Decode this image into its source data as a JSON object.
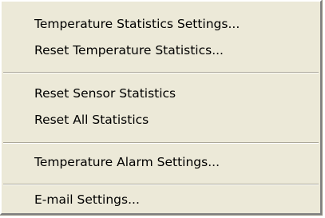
{
  "menu": {
    "items": [
      {
        "label": "Temperature Statistics Settings..."
      },
      {
        "label": "Reset Temperature Statistics..."
      },
      {
        "label": "Reset Sensor Statistics"
      },
      {
        "label": "Reset All Statistics"
      },
      {
        "label": "Temperature Alarm Settings..."
      },
      {
        "label": "E-mail Settings..."
      }
    ]
  },
  "colors": {
    "menu_background": "#ece9d8",
    "separator_shadow": "#aca899",
    "separator_highlight": "#ffffff",
    "text": "#000000"
  }
}
